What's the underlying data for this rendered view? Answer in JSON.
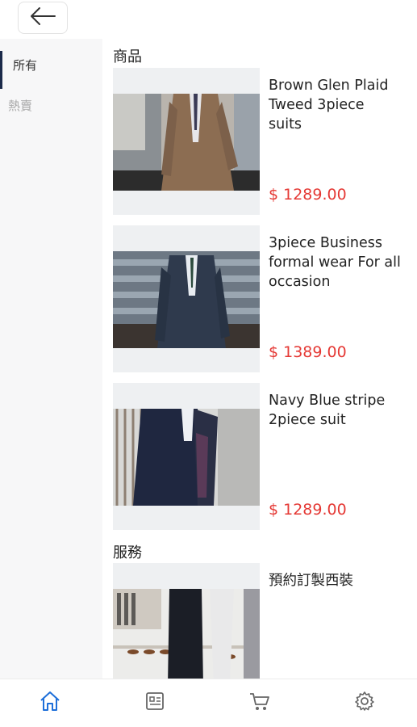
{
  "header": {
    "back_icon": "arrow-left-icon"
  },
  "sidebar": {
    "items": [
      {
        "label": "所有",
        "active": true
      },
      {
        "label": "熱賣",
        "active": false
      }
    ]
  },
  "sections": {
    "products_title": "商品",
    "services_title": "服務"
  },
  "products": [
    {
      "title": "Brown Glen Plaid Tweed 3piece suits",
      "price": "$ 1289.00"
    },
    {
      "title": "3piece Business formal wear For all occasion",
      "price": "$ 1389.00"
    },
    {
      "title": "Navy Blue stripe 2piece suit",
      "price": "$ 1289.00"
    }
  ],
  "services": [
    {
      "title": "預約訂製西裝"
    }
  ],
  "bottom_nav": [
    {
      "icon": "home-icon",
      "active": true
    },
    {
      "icon": "news-icon",
      "active": false
    },
    {
      "icon": "cart-icon",
      "active": false
    },
    {
      "icon": "gear-icon",
      "active": false
    }
  ],
  "colors": {
    "price": "#e53935",
    "accent": "#1e6fd9",
    "sidebar_indicator": "#1b2a4a"
  }
}
